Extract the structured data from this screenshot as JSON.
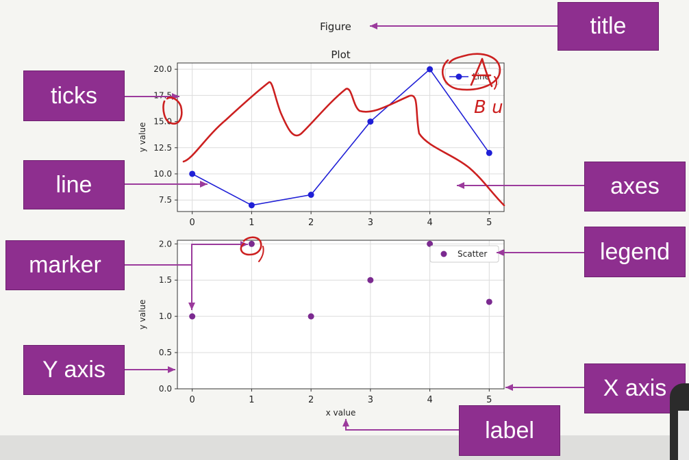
{
  "figure": {
    "title": "Figure"
  },
  "callouts": {
    "title": "title",
    "ticks": "ticks",
    "line": "line",
    "axes": "axes",
    "marker": "marker",
    "legend": "legend",
    "y_axis": "Y axis",
    "x_axis": "X axis",
    "label": "label"
  },
  "annotations": {
    "handwriting": "B u"
  },
  "colors": {
    "callout_bg": "#8e2f8f",
    "line_series": "#1f1fd6",
    "scatter_series": "#7b2a90",
    "annotation": "#cc2020"
  },
  "chart_data": [
    {
      "type": "line",
      "title": "Plot",
      "xlabel": "",
      "ylabel": "y value",
      "x": [
        0,
        1,
        2,
        3,
        4,
        5
      ],
      "series": [
        {
          "name": "Line",
          "values": [
            10,
            7,
            8,
            15,
            20,
            12
          ]
        }
      ],
      "xticks": [
        "0",
        "1",
        "2",
        "3",
        "4",
        "5"
      ],
      "yticks": [
        "7.5",
        "10.0",
        "12.5",
        "15.0",
        "17.5",
        "20.0"
      ],
      "xlim": [
        -0.25,
        5.25
      ],
      "ylim": [
        6.4,
        20.6
      ],
      "grid": true,
      "legend": "top-right"
    },
    {
      "type": "scatter",
      "title": "",
      "xlabel": "x value",
      "ylabel": "y value",
      "x": [
        0,
        1,
        2,
        3,
        4,
        5
      ],
      "series": [
        {
          "name": "Scatter",
          "values": [
            1.0,
            2.0,
            1.0,
            1.5,
            2.0,
            1.2
          ]
        }
      ],
      "xticks": [
        "0",
        "1",
        "2",
        "3",
        "4",
        "5"
      ],
      "yticks": [
        "0.0",
        "0.5",
        "1.0",
        "1.5",
        "2.0"
      ],
      "xlim": [
        -0.25,
        5.25
      ],
      "ylim": [
        0,
        2.05
      ],
      "grid": true,
      "legend": "top-right"
    }
  ]
}
